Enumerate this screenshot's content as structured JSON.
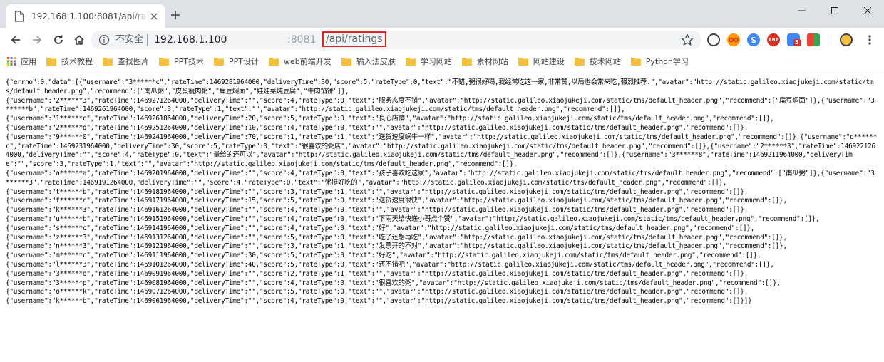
{
  "tab": {
    "title": "192.168.1.100:8081/api/ratings",
    "close_label": "×",
    "new_tab_label": "+"
  },
  "window": {
    "minimize": "—",
    "maximize": "☐",
    "close": "✕"
  },
  "omnibox": {
    "security_label": "不安全",
    "url_host": "192.168.1.100",
    "url_port": ":8081",
    "url_path": "/api/ratings"
  },
  "extensions": [
    {
      "name": "opera",
      "color": "#3c4043",
      "text": ""
    },
    {
      "name": "infinity",
      "color": "#e8710a",
      "text": "∞"
    },
    {
      "name": "skype",
      "color": "#1a73e8",
      "text": ""
    },
    {
      "name": "adblock",
      "color": "#d93025",
      "text": "ABP"
    },
    {
      "name": "google-ext",
      "color": "#4285f4",
      "text": "5",
      "badge_color": "#d93025"
    },
    {
      "name": "translate",
      "color": "#34a853",
      "text": ""
    }
  ],
  "bookmarks": {
    "apps_label": "应用",
    "items": [
      "技术教程",
      "查找图片",
      "PPT技术",
      "PPT设计",
      "web前端开发",
      "输入法皮肤",
      "学习网站",
      "素材网站",
      "网站建设",
      "技术网站",
      "Python学习"
    ],
    "folder_color": "#f6c03f"
  },
  "response_text": "{\"errno\":0,\"data\":[{\"username\":\"3******c\",\"rateTime\":1469281964000,\"deliveryTime\":30,\"score\":5,\"rateType\":0,\"text\":\"不错,粥很好喝,我经常吃这一家,非常赞,以后也会常来吃,强烈推荐.\",\"avatar\":\"http://static.galileo.xiaojukeji.com/static/tms/default_header.png\",\"recommend\":[\"南瓜粥\",\"皮蛋瘦肉粥\",\"扁豆焖面\",\"娃娃菜炖豆腐\",\"牛肉馅饼\"]},\n{\"username\":\"2******3\",\"rateTime\":1469271264000,\"deliveryTime\":\"\",\"score\":4,\"rateType\":0,\"text\":\"服务态度不错\",\"avatar\":\"http://static.galileo.xiaojukeji.com/static/tms/default_header.png\",\"recommend\":[\"扁豆焖面\"]},{\"username\":\"3******b\",\"rateTime\":1469261964000,\"score\":3,\"rateType\":1,\"text\":\"\",\"avatar\":\"http://static.galileo.xiaojukeji.com/static/tms/default_header.png\",\"recommend\":[]},\n{\"username\":\"1******c\",\"rateTime\":1469261864000,\"deliveryTime\":20,\"score\":5,\"rateType\":0,\"text\":\"良心店铺\",\"avatar\":\"http://static.galileo.xiaojukeji.com/static/tms/default_header.png\",\"recommend\":[]},\n{\"username\":\"2******d\",\"rateTime\":1469251264000,\"deliveryTime\":10,\"score\":4,\"rateType\":0,\"text\":\"\",\"avatar\":\"http://static.galileo.xiaojukeji.com/static/tms/default_header.png\",\"recommend\":[]},\n{\"username\":\"9******0\",\"rateTime\":1469241964000,\"deliveryTime\":70,\"score\":1,\"rateType\":1,\"text\":\"送货速度蜗牛一样\",\"avatar\":\"http://static.galileo.xiaojukeji.com/static/tms/default_header.png\",\"recommend\":[]},{\"username\":\"d******c\",\"rateTime\":1469231964000,\"deliveryTime\":30,\"score\":5,\"rateType\":0,\"text\":\"很喜欢的粥店\",\"avatar\":\"http://static.galileo.xiaojukeji.com/static/tms/default_header.png\",\"recommend\":[]},{\"username\":\"2******3\",\"rateTime\":1469221264000,\"deliveryTime\":\"\",\"score\":4,\"rateType\":0,\"text\":\"量给的还可以\",\"avatar\":\"http://static.galileo.xiaojukeji.com/static/tms/default_header.png\",\"recommend\":[]},{\"username\":\"3******8\",\"rateTime\":1469211964000,\"deliveryTime\":\"\",\"score\":3,\"rateType\":1,\"text\":\"\",\"avatar\":\"http://static.galileo.xiaojukeji.com/static/tms/default_header.png\",\"recommend\":[]},\n{\"username\":\"a******a\",\"rateTime\":1469201964000,\"deliveryTime\":\"\",\"score\":4,\"rateType\":0,\"text\":\"孩子喜欢吃这家\",\"avatar\":\"http://static.galileo.xiaojukeji.com/static/tms/default_header.png\",\"recommend\":[\"南瓜粥\"]},{\"username\":\"3******3\",\"rateTime\":1469191264000,\"deliveryTime\":\"\",\"score\":4,\"rateType\":0,\"text\":\"粥挺好吃的\",\"avatar\":\"http://static.galileo.xiaojukeji.com/static/tms/default_header.png\",\"recommend\":[]},\n{\"username\":\"t******b\",\"rateTime\":1469181964000,\"deliveryTime\":\"\",\"score\":3,\"rateType\":1,\"text\":\"\",\"avatar\":\"http://static.galileo.xiaojukeji.com/static/tms/default_header.png\",\"recommend\":[]},\n{\"username\":\"f******c\",\"rateTime\":1469171964000,\"deliveryTime\":15,\"score\":5,\"rateType\":0,\"text\":\"送货速度很快\",\"avatar\":\"http://static.galileo.xiaojukeji.com/static/tms/default_header.png\",\"recommend\":[]},\n{\"username\":\"k******3\",\"rateTime\":1469161264000,\"deliveryTime\":\"\",\"score\":4,\"rateType\":0,\"text\":\"\",\"avatar\":\"http://static.galileo.xiaojukeji.com/static/tms/default_header.png\",\"recommend\":[]},\n{\"username\":\"u******b\",\"rateTime\":1469151964000,\"deliveryTime\":\"\",\"score\":4,\"rateType\":0,\"text\":\"下雨天给快递小哥点个赞\",\"avatar\":\"http://static.galileo.xiaojukeji.com/static/tms/default_header.png\",\"recommend\":[]},\n{\"username\":\"s******c\",\"rateTime\":1469141964000,\"deliveryTime\":\"\",\"score\":4,\"rateType\":0,\"text\":\"好\",\"avatar\":\"http://static.galileo.xiaojukeji.com/static/tms/default_header.png\",\"recommend\":[]},\n{\"username\":\"z******3\",\"rateTime\":1469131264000,\"deliveryTime\":\"\",\"score\":5,\"rateType\":0,\"text\":\"吃了还想再吃\",\"avatar\":\"http://static.galileo.xiaojukeji.com/static/tms/default_header.png\",\"recommend\":[]},\n{\"username\":\"n******3\",\"rateTime\":1469121964000,\"deliveryTime\":\"\",\"score\":3,\"rateType\":1,\"text\":\"发票开的不对\",\"avatar\":\"http://static.galileo.xiaojukeji.com/static/tms/default_header.png\",\"recommend\":[]},\n{\"username\":\"m******c\",\"rateTime\":1469111964000,\"deliveryTime\":30,\"score\":5,\"rateType\":0,\"text\":\"好吃\",\"avatar\":\"http://static.galileo.xiaojukeji.com/static/tms/default_header.png\",\"recommend\":[]},\n{\"username\":\"l******3\",\"rateTime\":1469101264000,\"deliveryTime\":40,\"score\":5,\"rateType\":0,\"text\":\"还不错吧\",\"avatar\":\"http://static.galileo.xiaojukeji.com/static/tms/default_header.png\",\"recommend\":[]},\n{\"username\":\"3******o\",\"rateTime\":1469091964000,\"deliveryTime\":\"\",\"score\":2,\"rateType\":1,\"text\":\"\",\"avatar\":\"http://static.galileo.xiaojukeji.com/static/tms/default_header.png\",\"recommend\":[]},\n{\"username\":\"3******p\",\"rateTime\":1469081964000,\"deliveryTime\":\"\",\"score\":4,\"rateType\":0,\"text\":\"很喜欢的粥\",\"avatar\":\"http://static.galileo.xiaojukeji.com/static/tms/default_header.png\",\"recommend\":[]},\n{\"username\":\"o******k\",\"rateTime\":1469071264000,\"deliveryTime\":\"\",\"score\":5,\"rateType\":0,\"text\":\"\",\"avatar\":\"http://static.galileo.xiaojukeji.com/static/tms/default_header.png\",\"recommend\":[]},\n{\"username\":\"k******b\",\"rateTime\":1469061964000,\"deliveryTime\":\"\",\"score\":4,\"rateType\":0,\"text\":\"\",\"avatar\":\"http://static.galileo.xiaojukeji.com/static/tms/default_header.png\",\"recommend\":[]}]}"
}
